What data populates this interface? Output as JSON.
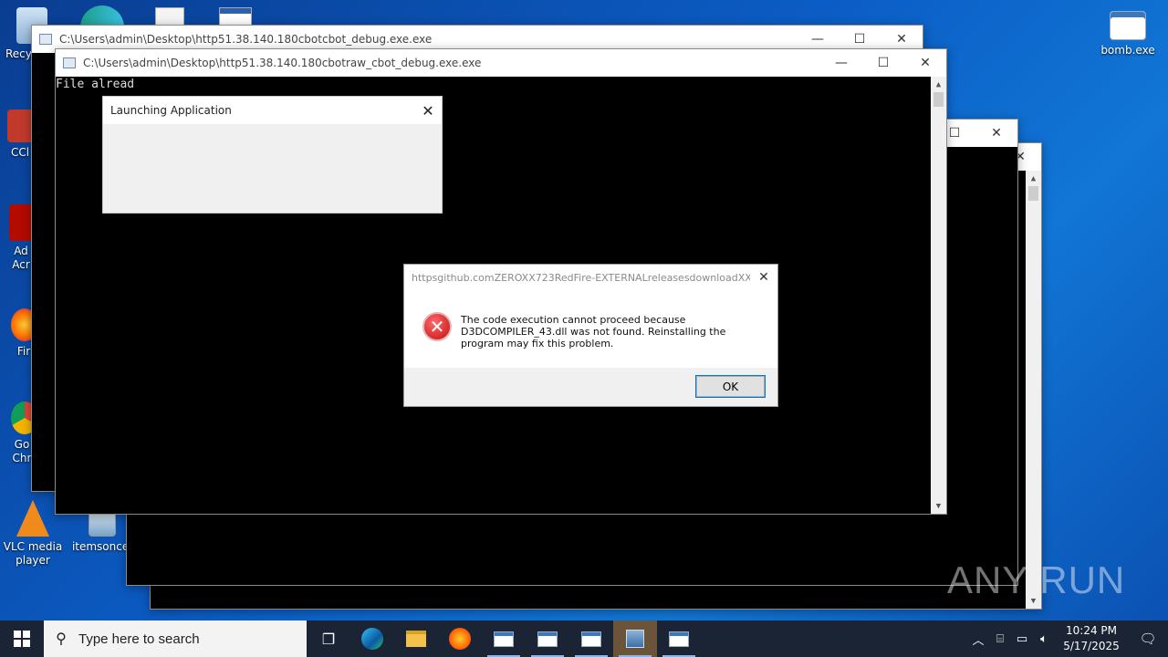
{
  "desktop": {
    "icons": [
      {
        "label": "RecyErr"
      },
      {
        "label": "CCl"
      },
      {
        "label": "Ad Acr"
      },
      {
        "label": "Fir"
      },
      {
        "label": "Go Chr"
      },
      {
        "label": "VLC media player"
      },
      {
        "label": "itemsonce."
      },
      {
        "label": "bomb.exe"
      }
    ]
  },
  "windows": {
    "back_console": {
      "title": "C:\\Users\\admin\\Desktop\\http51.38.140.180cbotcbot_debug.exe.exe"
    },
    "front_console": {
      "title": "C:\\Users\\admin\\Desktop\\http51.38.140.180cbotraw_cbot_debug.exe.exe",
      "output": "File alread"
    },
    "launching": {
      "title": "Launching Application"
    },
    "error": {
      "title": "httpsgithub.comZEROXX723RedFire-EXTERNALreleasesdownloadXX...",
      "message": "The code execution cannot proceed because D3DCOMPILER_43.dll was not found. Reinstalling the program may fix this problem.",
      "ok_label": "OK"
    }
  },
  "taskbar": {
    "search_placeholder": "Type here to search",
    "time": "10:24 PM",
    "date": "5/17/2025"
  },
  "watermark": "ANY RUN"
}
